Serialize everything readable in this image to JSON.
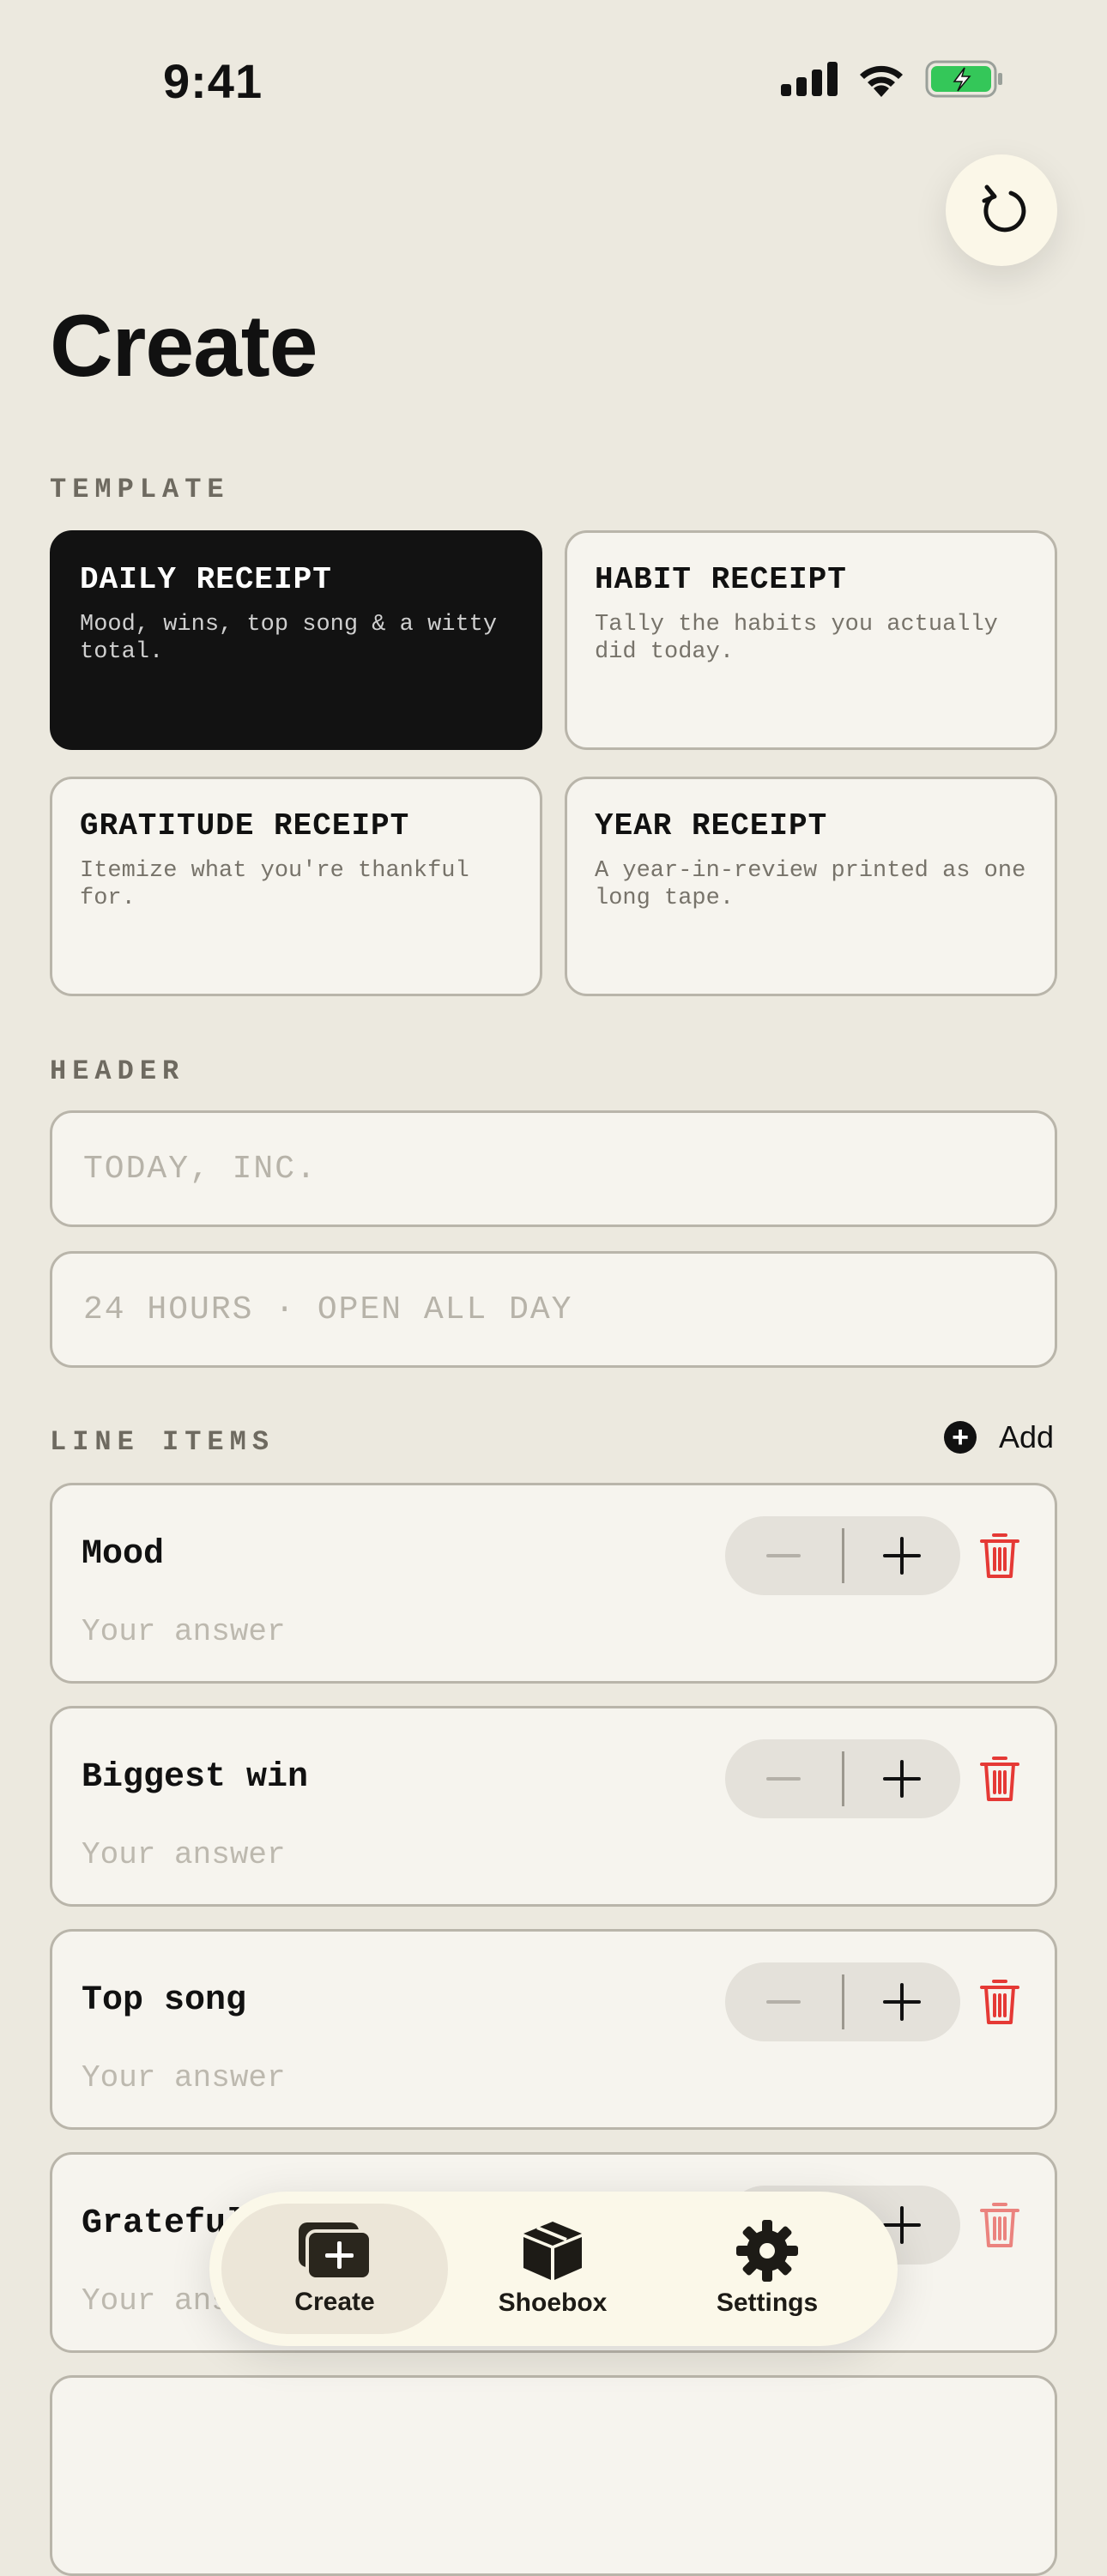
{
  "status_bar": {
    "time": "9:41"
  },
  "page": {
    "title": "Create"
  },
  "template_section": {
    "label": "TEMPLATE",
    "cards": [
      {
        "title": "DAILY RECEIPT",
        "description": "Mood, wins, top song & a witty total.",
        "selected": true
      },
      {
        "title": "HABIT RECEIPT",
        "description": "Tally the habits you actually did today.",
        "selected": false
      },
      {
        "title": "GRATITUDE RECEIPT",
        "description": "Itemize what you're thankful for.",
        "selected": false
      },
      {
        "title": "YEAR RECEIPT",
        "description": "A year-in-review printed as one long tape.",
        "selected": false
      }
    ]
  },
  "header_section": {
    "label": "HEADER",
    "title_placeholder": "TODAY, INC.",
    "subtitle_placeholder": "24 HOURS · OPEN ALL DAY"
  },
  "line_items": {
    "label": "LINE ITEMS",
    "add_label": "Add",
    "items": [
      {
        "name": "Mood",
        "answer_placeholder": "Your answer"
      },
      {
        "name": "Biggest win",
        "answer_placeholder": "Your answer"
      },
      {
        "name": "Top song",
        "answer_placeholder": "Your answer"
      },
      {
        "name": "Grateful for",
        "answer_placeholder": "Your answer"
      }
    ]
  },
  "tab_bar": {
    "tabs": [
      {
        "label": "Create",
        "icon": "create-icon",
        "active": true
      },
      {
        "label": "Shoebox",
        "icon": "box-icon",
        "active": false
      },
      {
        "label": "Settings",
        "icon": "gear-icon",
        "active": false
      }
    ]
  },
  "colors": {
    "background": "#ece9df",
    "selected_card": "#121212",
    "delete": "#e53935",
    "battery": "#34c759"
  }
}
